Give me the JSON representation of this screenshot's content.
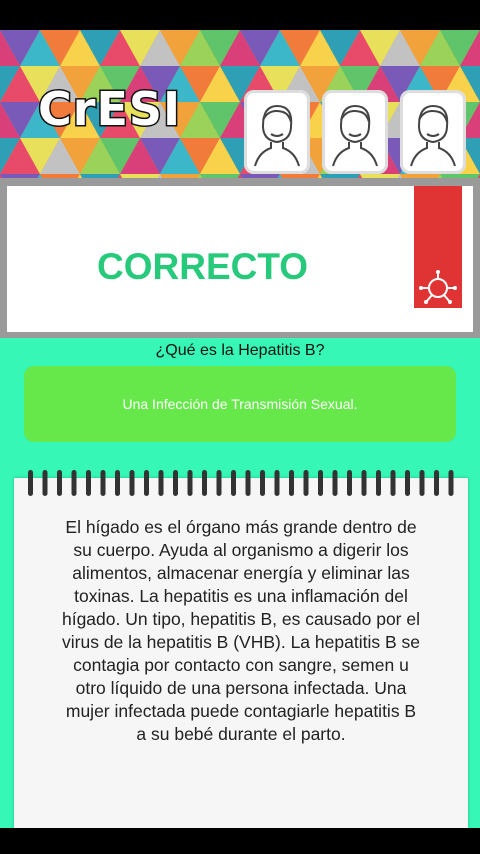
{
  "app": {
    "logo_text": "CrESI"
  },
  "header": {
    "avatars": [
      "avatar-1",
      "avatar-2",
      "avatar-3"
    ]
  },
  "result": {
    "text": "CORRECTO",
    "icon": "virus-icon"
  },
  "quiz": {
    "question": "¿Qué es la Hepatitis B?",
    "answer": "Una Infección de Transmisión Sexual."
  },
  "explanation": {
    "text": "El hígado es el órgano más grande dentro de su cuerpo. Ayuda al organismo a digerir los alimentos, almacenar energía y eliminar las toxinas. La hepatitis es una inflamación del hígado. Un tipo, hepatitis B, es causado por el virus de la hepatitis B (VHB). La hepatitis B se contagia por contacto con sangre, semen u otro líquido de una persona infectada. Una mujer infectada puede contagiarle hepatitis B a su bebé durante el parto."
  },
  "colors": {
    "correct": "#27c97a",
    "answer_bg": "#66e84a",
    "main_bg": "#37f7b7",
    "virus_tab": "#e03333"
  }
}
